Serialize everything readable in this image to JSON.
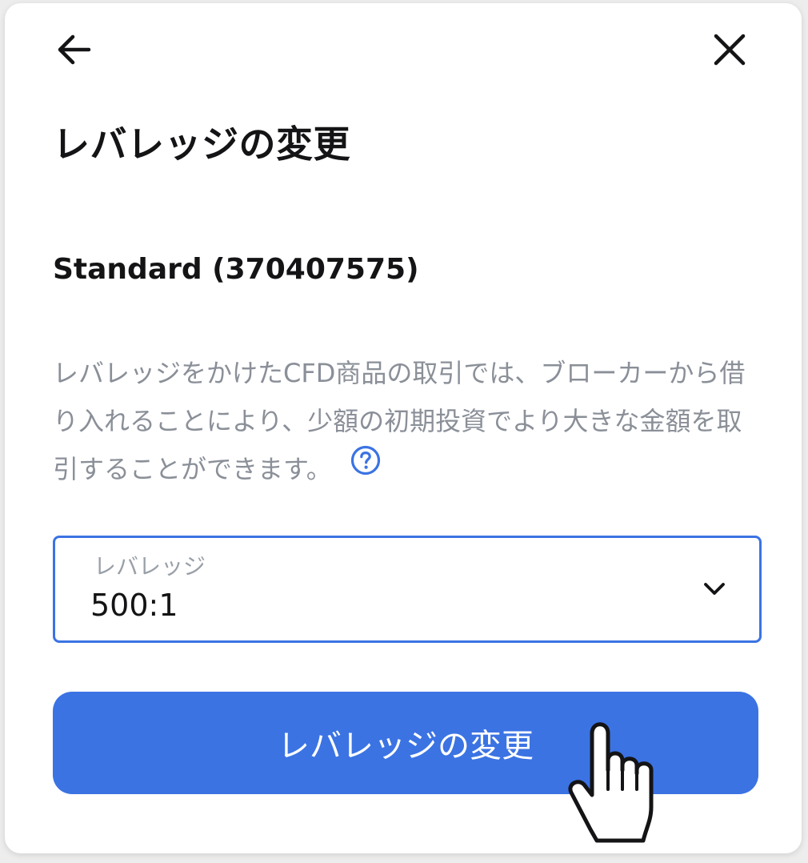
{
  "header": {
    "back_icon": "arrow-left-icon",
    "close_icon": "close-icon"
  },
  "title": "レバレッジの変更",
  "account": "Standard (370407575)",
  "description": "レバレッジをかけたCFD商品の取引では、ブローカーから借り入れることにより、少額の初期投資でより大きな金額を取引することができます。",
  "help_icon": "question-circle-icon",
  "leverage_select": {
    "label": "レバレッジ",
    "value": "500:1",
    "icon": "chevron-down-icon"
  },
  "submit_button": {
    "label": "レバレッジの変更"
  },
  "cursor_icon": "hand-pointer-icon",
  "colors": {
    "accent": "#3b73e3",
    "text_primary": "#141416",
    "text_secondary": "#8a8f98",
    "background": "#ffffff"
  }
}
